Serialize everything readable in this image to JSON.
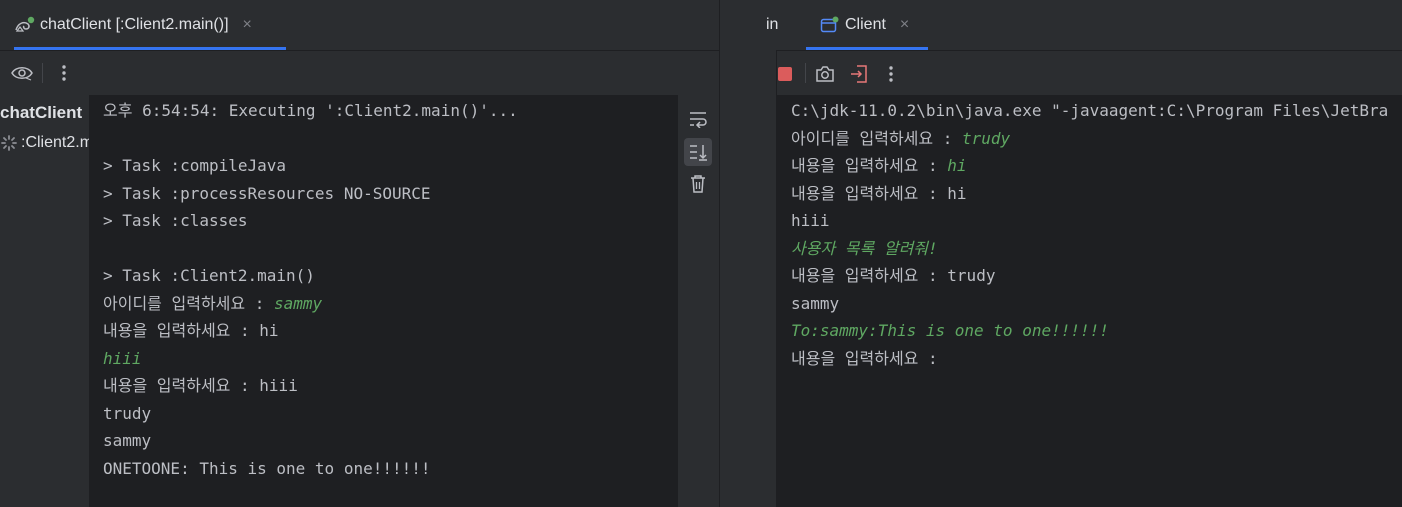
{
  "left_panel": {
    "tab_title": "chatClient [:Client2.main()]",
    "tab_close": "×",
    "tree": {
      "root_label": "chatClient",
      "child_label": ":Client2.m"
    },
    "console_lines": [
      {
        "parts": [
          {
            "text": "오후 6:54:54: Executing ':Client2.main()'...",
            "input": false
          }
        ]
      },
      {
        "parts": [
          {
            "text": "",
            "input": false
          }
        ]
      },
      {
        "parts": [
          {
            "text": "> Task :compileJava",
            "input": false
          }
        ]
      },
      {
        "parts": [
          {
            "text": "> Task :processResources NO-SOURCE",
            "input": false
          }
        ]
      },
      {
        "parts": [
          {
            "text": "> Task :classes",
            "input": false
          }
        ]
      },
      {
        "parts": [
          {
            "text": "",
            "input": false
          }
        ]
      },
      {
        "parts": [
          {
            "text": "> Task :Client2.main()",
            "input": false
          }
        ]
      },
      {
        "parts": [
          {
            "text": "아이디를 입력하세요 : ",
            "input": false
          },
          {
            "text": "sammy",
            "input": true
          }
        ]
      },
      {
        "parts": [
          {
            "text": "내용을 입력하세요 : hi",
            "input": false
          }
        ]
      },
      {
        "parts": [
          {
            "text": "hiii",
            "input": true
          }
        ]
      },
      {
        "parts": [
          {
            "text": "내용을 입력하세요 : hiii",
            "input": false
          }
        ]
      },
      {
        "parts": [
          {
            "text": "trudy",
            "input": false
          }
        ]
      },
      {
        "parts": [
          {
            "text": "sammy",
            "input": false
          }
        ]
      },
      {
        "parts": [
          {
            "text": "ONETOONE: This is one to one!!!!!!",
            "input": false
          }
        ]
      }
    ]
  },
  "right_panel": {
    "partial_tab_label": "in",
    "tab_title": "Client",
    "tab_close": "×",
    "console_lines": [
      {
        "parts": [
          {
            "text": "C:\\jdk-11.0.2\\bin\\java.exe \"-javaagent:C:\\Program Files\\JetBra",
            "input": false
          }
        ]
      },
      {
        "parts": [
          {
            "text": "아이디를 입력하세요 : ",
            "input": false
          },
          {
            "text": "trudy",
            "input": true
          }
        ]
      },
      {
        "parts": [
          {
            "text": "내용을 입력하세요 : ",
            "input": false
          },
          {
            "text": "hi",
            "input": true
          }
        ]
      },
      {
        "parts": [
          {
            "text": "내용을 입력하세요 : hi",
            "input": false
          }
        ]
      },
      {
        "parts": [
          {
            "text": "hiii",
            "input": false
          }
        ]
      },
      {
        "parts": [
          {
            "text": "사용자 목록 알려줘!",
            "input": true
          }
        ]
      },
      {
        "parts": [
          {
            "text": "내용을 입력하세요 : trudy",
            "input": false
          }
        ]
      },
      {
        "parts": [
          {
            "text": "sammy",
            "input": false
          }
        ]
      },
      {
        "parts": [
          {
            "text": "To:sammy:This is one to one!!!!!!",
            "input": true
          }
        ]
      },
      {
        "parts": [
          {
            "text": "내용을 입력하세요 : ",
            "input": false
          }
        ]
      }
    ]
  },
  "icons": {
    "run_config": "gradle-run-icon",
    "eye": "eye-icon",
    "more": "more-vertical-icon",
    "soft_wrap": "soft-wrap-icon",
    "scroll_end": "scroll-to-end-icon",
    "clear": "trash-icon",
    "app": "application-icon",
    "stop": "stop-icon",
    "camera": "camera-icon",
    "exit": "exit-icon",
    "spinner": "loading-spinner-icon"
  },
  "colors": {
    "background": "#2b2d30",
    "console": "#1e1f22",
    "text": "#bcbec4",
    "user_input": "#5fa862",
    "accent": "#3574f0",
    "stop": "#db5c5c"
  }
}
